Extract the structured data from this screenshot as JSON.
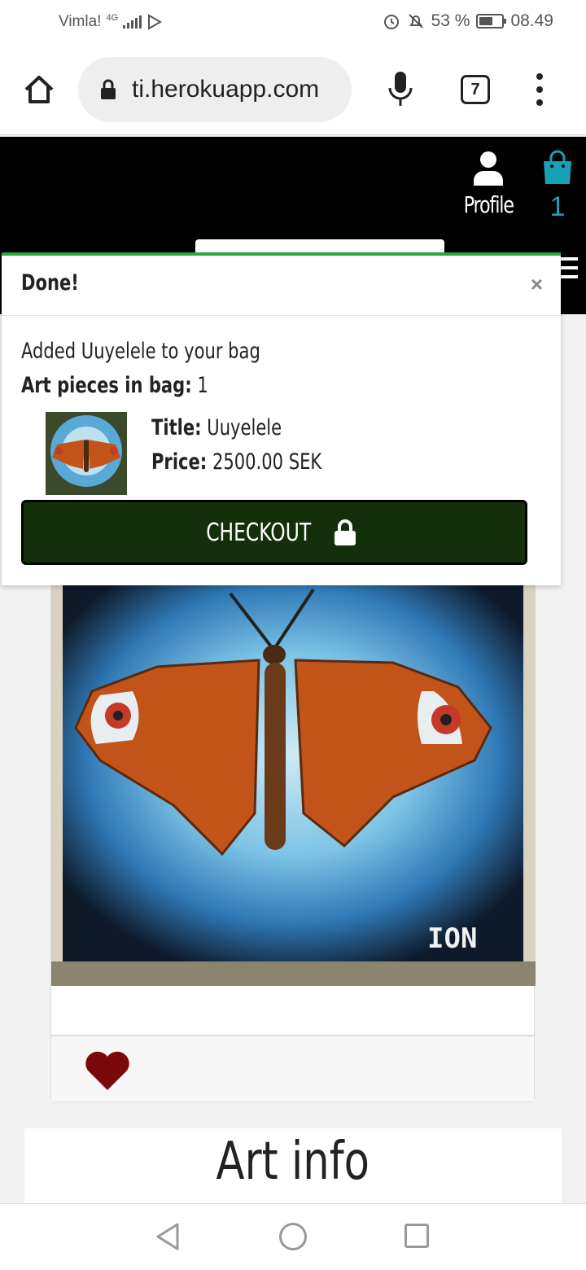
{
  "status_bar": {
    "carrier": "Vimla!",
    "network": "4G",
    "battery": "53 %",
    "time": "08.49"
  },
  "browser": {
    "url": "ti.herokuapp.com",
    "tab_count": "7"
  },
  "header": {
    "profile_label": "Profile",
    "bag_count": "1",
    "accent_color": "#17a2b8"
  },
  "toast": {
    "title": "Done!",
    "close": "×",
    "message": "Added Uuyelele to your bag",
    "count_label": "Art pieces in bag:",
    "count_value": "1",
    "item": {
      "title_label": "Title:",
      "title_value": "Uuyelele",
      "price_label": "Price:",
      "price_value": "2500.00 SEK"
    },
    "checkout_label": "CHECKOUT",
    "accent_color": "#28a745"
  },
  "artwork": {
    "signature": "ION"
  },
  "art_info": {
    "title": "Art info"
  }
}
